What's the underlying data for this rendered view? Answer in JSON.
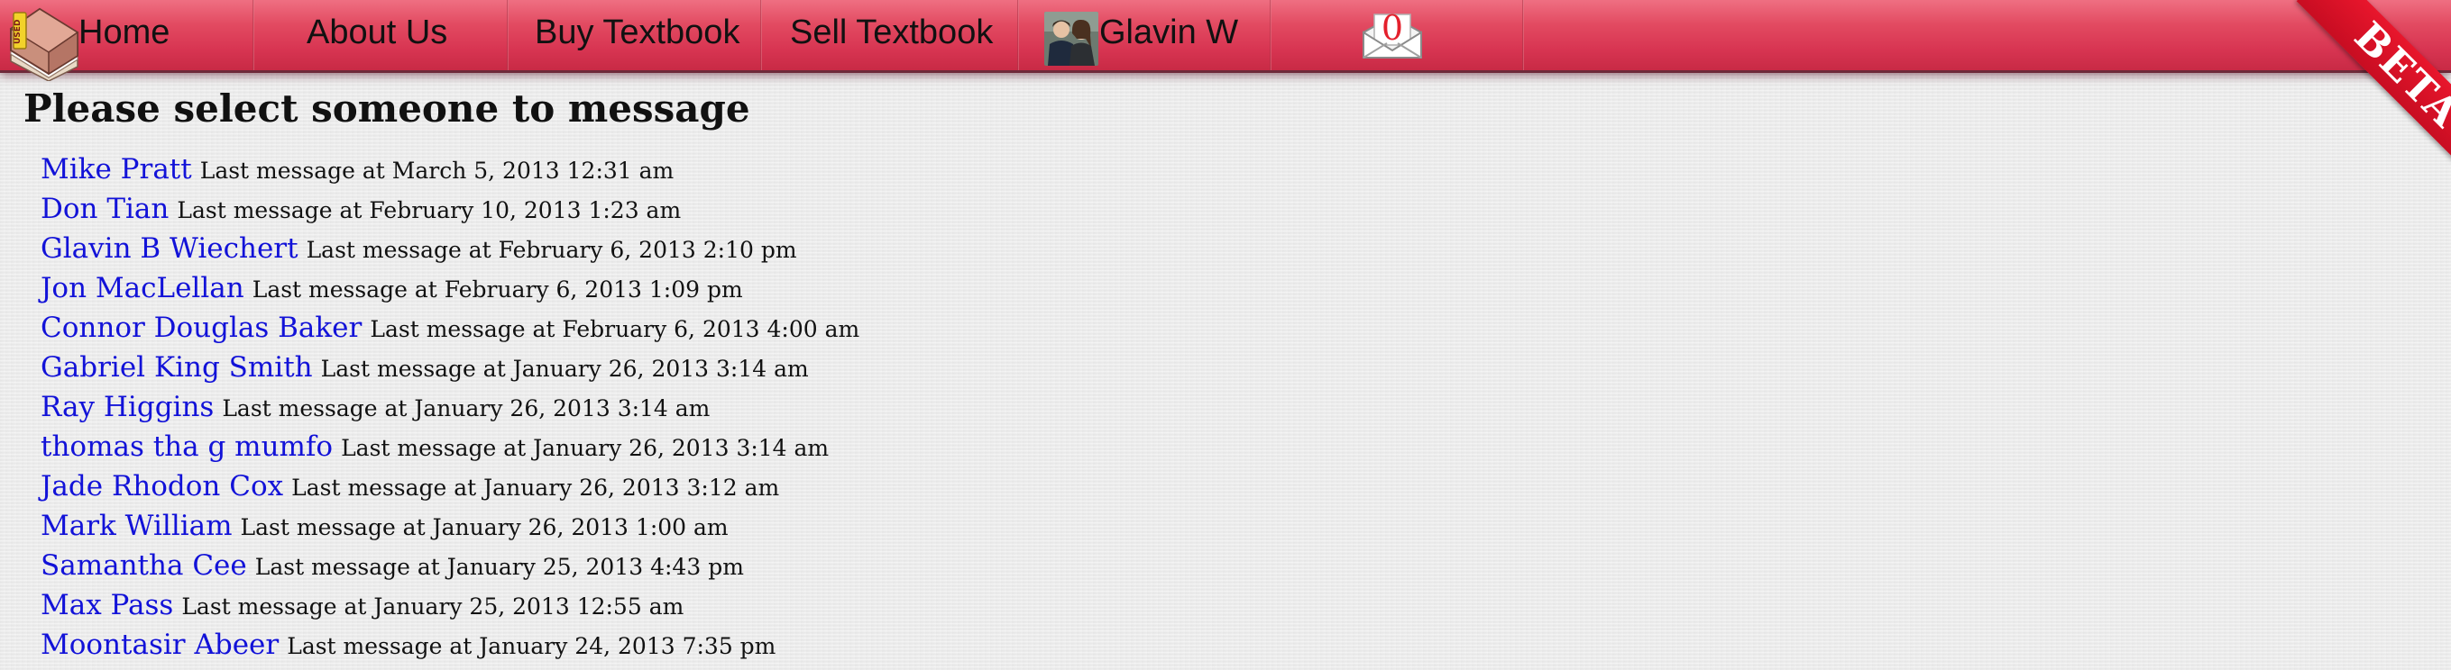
{
  "nav": {
    "items": [
      {
        "label": "Home"
      },
      {
        "label": "About Us"
      },
      {
        "label": "Buy Textbook"
      },
      {
        "label": "Sell Textbook"
      }
    ],
    "user_name": "Glavin W",
    "message_count": "0",
    "beta_label": "BETA",
    "logo_text": "USED"
  },
  "colors": {
    "nav_bar": "#d83552",
    "link": "#1212d8",
    "beta_ribbon": "#d81428",
    "badge_count": "#e4202c"
  },
  "icons": {
    "logo": "textbook-logo-icon",
    "avatar": "user-avatar",
    "messages": "envelope-icon"
  },
  "page": {
    "title": "Please select someone to message"
  },
  "messages": [
    {
      "name": "Mike Pratt",
      "meta": "Last message at March 5, 2013 12:31 am"
    },
    {
      "name": "Don Tian",
      "meta": "Last message at February 10, 2013 1:23 am"
    },
    {
      "name": "Glavin B Wiechert",
      "meta": "Last message at February 6, 2013 2:10 pm"
    },
    {
      "name": "Jon MacLellan",
      "meta": "Last message at February 6, 2013 1:09 pm"
    },
    {
      "name": "Connor Douglas Baker",
      "meta": "Last message at February 6, 2013 4:00 am"
    },
    {
      "name": "Gabriel King Smith",
      "meta": "Last message at January 26, 2013 3:14 am"
    },
    {
      "name": "Ray Higgins",
      "meta": "Last message at January 26, 2013 3:14 am"
    },
    {
      "name": "thomas tha g mumfo",
      "meta": "Last message at January 26, 2013 3:14 am"
    },
    {
      "name": "Jade Rhodon Cox",
      "meta": "Last message at January 26, 2013 3:12 am"
    },
    {
      "name": "Mark William",
      "meta": "Last message at January 26, 2013 1:00 am"
    },
    {
      "name": "Samantha Cee",
      "meta": "Last message at January 25, 2013 4:43 pm"
    },
    {
      "name": "Max Pass",
      "meta": "Last message at January 25, 2013 12:55 am"
    },
    {
      "name": "Moontasir Abeer",
      "meta": "Last message at January 24, 2013 7:35 pm"
    }
  ]
}
